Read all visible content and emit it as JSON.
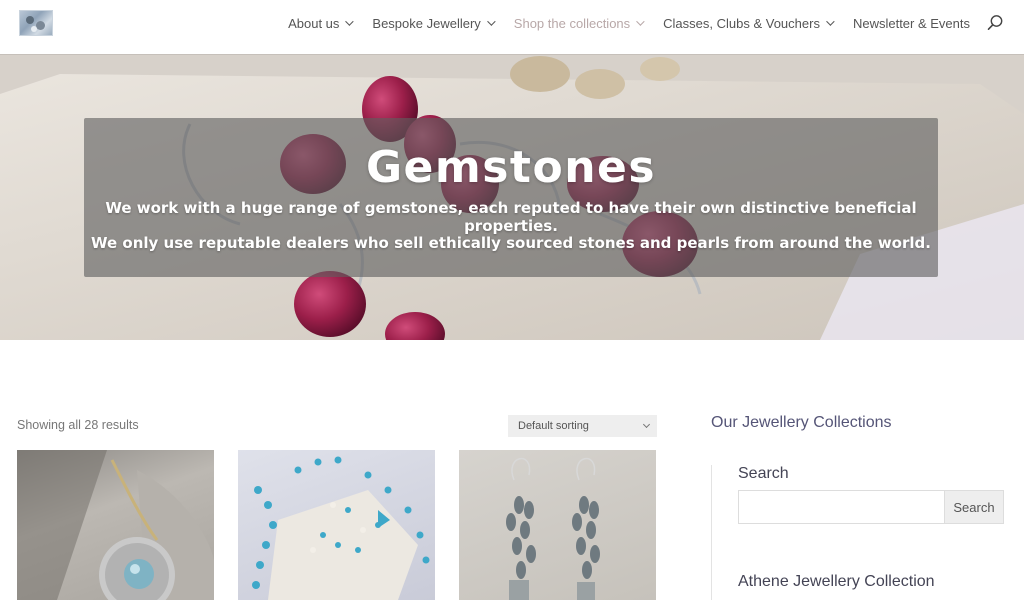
{
  "nav": {
    "items": [
      {
        "label": "About us",
        "dropdown": true,
        "active": false
      },
      {
        "label": "Bespoke Jewellery",
        "dropdown": true,
        "active": false
      },
      {
        "label": "Shop the collections",
        "dropdown": true,
        "active": true
      },
      {
        "label": "Classes, Clubs & Vouchers",
        "dropdown": true,
        "active": false
      },
      {
        "label": "Newsletter & Events",
        "dropdown": false,
        "active": false
      }
    ],
    "search_icon": "search-icon"
  },
  "hero": {
    "title": "Gemstones",
    "line1": "We work with a huge range of gemstones, each reputed to have their own distinctive beneficial properties.",
    "line2": "We only use reputable dealers who sell ethically sourced stones and pearls from around the world."
  },
  "shop": {
    "results_text": "Showing all 28 results",
    "sort_selected": "Default sorting"
  },
  "sidebar": {
    "title": "Our Jewellery Collections",
    "search_label": "Search",
    "search_button": "Search",
    "collection_heading": "Athene Jewellery Collection"
  },
  "colors": {
    "nav_text": "#555555",
    "nav_active": "#b8a8a8",
    "hero_overlay": "#5f5f5f",
    "sidebar_heading": "#555577"
  }
}
